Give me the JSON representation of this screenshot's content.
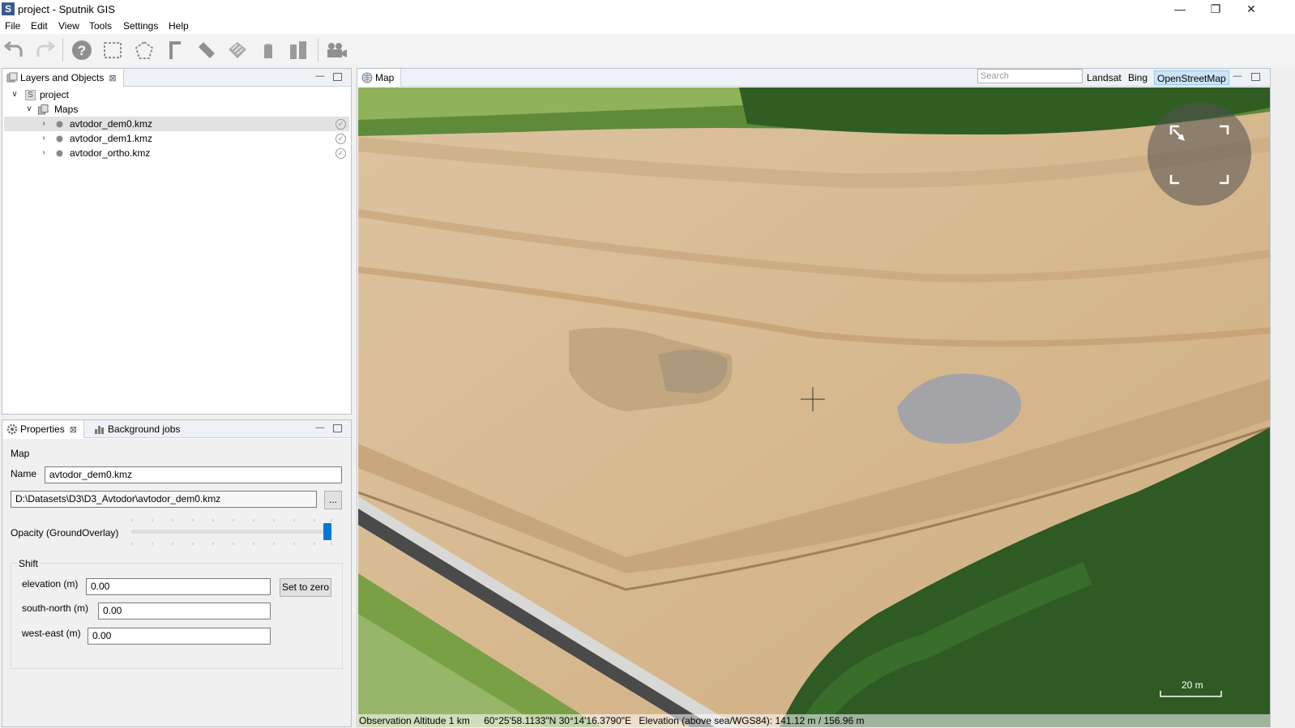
{
  "window": {
    "title": "project - Sputnik GIS",
    "app_icon_letter": "S",
    "minimize": "—",
    "restore": "❐",
    "close": "✕"
  },
  "menu": {
    "items": [
      "File",
      "Edit",
      "View",
      "Tools",
      "Settings",
      "Help"
    ]
  },
  "toolbar": {
    "icons": [
      "undo-icon",
      "redo-icon",
      "help-icon",
      "select-rect-icon",
      "select-polygon-icon",
      "ruler-tool-icon",
      "measure-line-icon",
      "area-measure-icon",
      "cylinder-icon",
      "volume-icon",
      "camera-icon"
    ]
  },
  "layers_panel": {
    "tab_label": "Layers and Objects",
    "tree": {
      "root": "project",
      "root_icon_letter": "S",
      "group": "Maps",
      "items": [
        "avtodor_dem0.kmz",
        "avtodor_dem1.kmz",
        "avtodor_ortho.kmz"
      ],
      "selected_index": 0
    }
  },
  "properties_panel": {
    "tab_label": "Properties",
    "tab2_label": "Background jobs",
    "section": "Map",
    "name_label": "Name",
    "name_value": "avtodor_dem0.kmz",
    "path_value": "D:\\Datasets\\D3\\D3_Avtodor\\avtodor_dem0.kmz",
    "browse_label": "...",
    "opacity_label": "Opacity (GroundOverlay)",
    "opacity_value": 1.0,
    "shift_label": "Shift",
    "elevation_label": "elevation (m)",
    "elevation_value": "0.00",
    "set_zero_label": "Set to zero",
    "south_north_label": "south-north (m)",
    "south_north_value": "0.00",
    "west_east_label": "west-east (m)",
    "west_east_value": "0.00"
  },
  "map_panel": {
    "tab_label": "Map",
    "search_placeholder": "Search",
    "basemaps": [
      "Landsat",
      "Bing",
      "OpenStreetMap"
    ],
    "active_basemap": "OpenStreetMap",
    "scale_label": "20 m",
    "status": {
      "altitude": "Observation Altitude 1 km",
      "coords": "60°25'58.1133\"N 30°14'16.3790\"E",
      "elevation": "Elevation (above sea/WGS84): 141.12 m / 156.96 m"
    }
  },
  "colors": {
    "sand": "#d8bf98",
    "forest": "#3f6b2a",
    "road": "#4a4a4a",
    "selection": "#cce4f7",
    "slider": "#0078d7"
  }
}
